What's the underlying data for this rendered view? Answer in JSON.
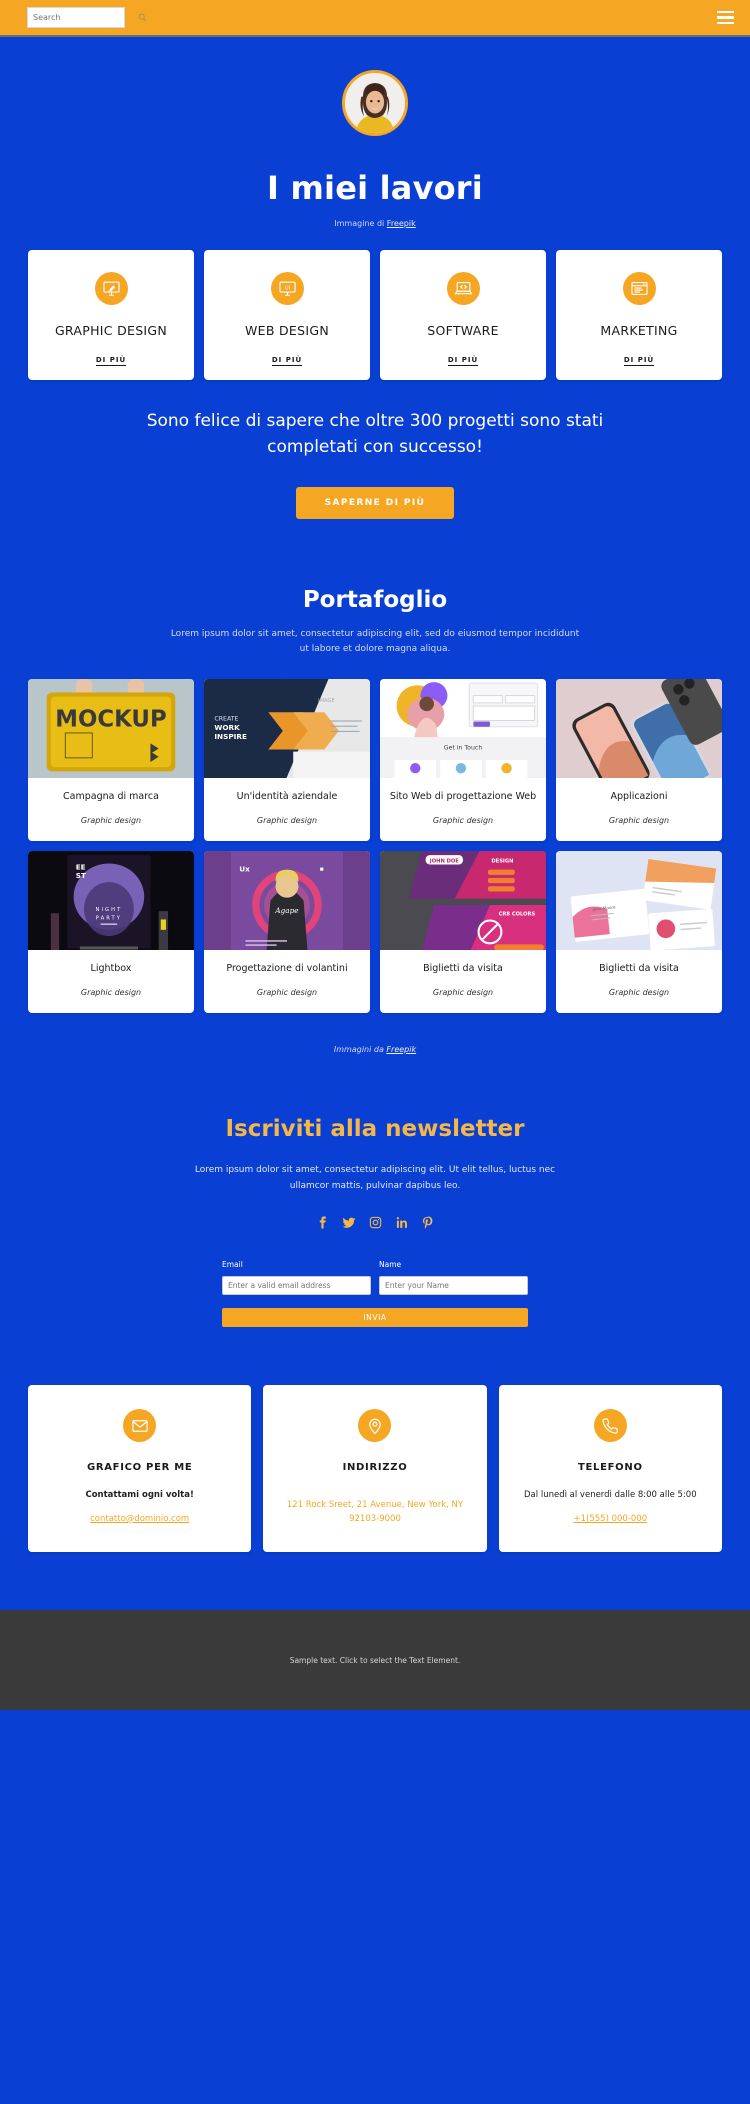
{
  "topbar": {
    "search_placeholder": "Search",
    "search_value": "",
    "search_icon": "search-icon",
    "menu_icon": "hamburger-menu-icon"
  },
  "hero": {
    "avatar_alt": "profile-photo",
    "title": "I miei lavori",
    "credit_prefix": "Immagine di ",
    "credit_link": "Freepik"
  },
  "services": [
    {
      "icon": "graphic-design-icon",
      "title": "GRAPHIC DESIGN",
      "more": "DI PIÙ"
    },
    {
      "icon": "web-design-ui-icon",
      "title": "WEB DESIGN",
      "more": "DI PIÙ"
    },
    {
      "icon": "software-code-icon",
      "title": "SOFTWARE",
      "more": "DI PIÙ"
    },
    {
      "icon": "marketing-browser-icon",
      "title": "MARKETING",
      "more": "DI PIÙ"
    }
  ],
  "stats": {
    "text": "Sono felice di sapere che oltre 300 progetti sono stati completati con successo!",
    "cta_label": "SAPERNE DI PIÙ"
  },
  "portfolio": {
    "title": "Portafoglio",
    "subtitle": "Lorem ipsum dolor sit amet, consectetur adipiscing elit, sed do eiusmod tempor incididunt ut labore et dolore magna aliqua.",
    "items": [
      {
        "name": "Campagna di marca",
        "category": "Graphic design",
        "thumb": "yellow-mockup-pouch"
      },
      {
        "name": "Un'identità aziendale",
        "category": "Graphic design",
        "thumb": "corporate-brochure"
      },
      {
        "name": "Sito Web di progettazione Web",
        "category": "Graphic design",
        "thumb": "website-landing-page"
      },
      {
        "name": "Applicazioni",
        "category": "Graphic design",
        "thumb": "phone-mockups"
      },
      {
        "name": "Lightbox",
        "category": "Graphic design",
        "thumb": "night-party-poster"
      },
      {
        "name": "Progettazione di volantini",
        "category": "Graphic design",
        "thumb": "purple-flyer"
      },
      {
        "name": "Biglietti da visita",
        "category": "Graphic design",
        "thumb": "pink-business-cards"
      },
      {
        "name": "Biglietti da visita",
        "category": "Graphic design",
        "thumb": "light-business-cards"
      }
    ],
    "credit_prefix": "Immagini da ",
    "credit_link": "Freepik"
  },
  "newsletter": {
    "title": "Iscriviti alla newsletter",
    "subtitle": "Lorem ipsum dolor sit amet, consectetur adipiscing elit. Ut elit tellus, luctus nec ullamcor mattis, pulvinar dapibus leo.",
    "socials": [
      {
        "name": "facebook-icon"
      },
      {
        "name": "twitter-icon"
      },
      {
        "name": "instagram-icon"
      },
      {
        "name": "linkedin-icon"
      },
      {
        "name": "pinterest-icon"
      }
    ],
    "email_label": "Email",
    "email_placeholder": "Enter a valid email address",
    "email_value": "",
    "name_label": "Name",
    "name_placeholder": "Enter your Name",
    "name_value": "",
    "submit_label": "INVIA"
  },
  "contacts": [
    {
      "icon": "envelope-icon",
      "title": "GRAFICO PER ME",
      "line1": "Contattami ogni volta!",
      "link": "contatto@dominio.com",
      "link_style": "underline"
    },
    {
      "icon": "map-pin-icon",
      "title": "INDIRIZZO",
      "line1": "",
      "link": "121 Rock Sreet, 21 Avenue, New York, NY 92103-9000",
      "link_style": "plain"
    },
    {
      "icon": "phone-icon",
      "title": "TELEFONO",
      "line1": "Dal lunedì al venerdì dalle 8:00 alle 5:00",
      "link": "+1(555) 000-000",
      "link_style": "underline"
    }
  ],
  "footer": {
    "text": "Sample text. Click to select the Text Element."
  },
  "colors": {
    "page_bg": "#0a3fd4",
    "accent": "#f5a623",
    "accent_soft": "#f5b846",
    "card_bg": "#ffffff",
    "footer_bg": "#3a3a3a"
  }
}
